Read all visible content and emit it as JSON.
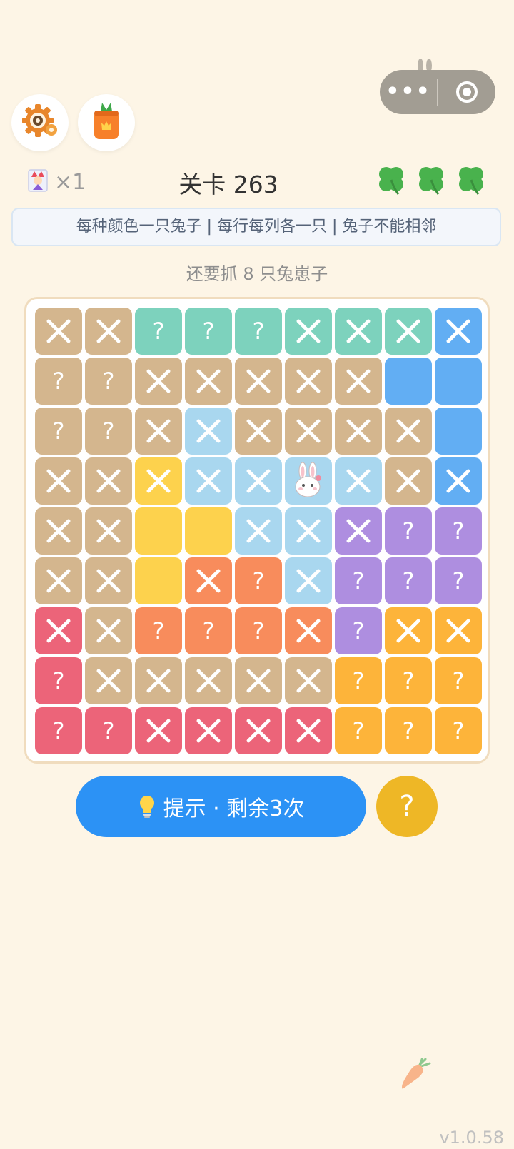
{
  "colors": {
    "tan": "#d4b68e",
    "teal": "#7dd2bd",
    "blue": "#62aef3",
    "lightblue": "#a9d7ef",
    "yellow": "#fdd24d",
    "purple": "#ae8ee0",
    "coral": "#f88c5c",
    "orange": "#fdb43a",
    "red": "#ec6479"
  },
  "capsule": {
    "more_icon": "more-dots-icon",
    "close_icon": "target-icon"
  },
  "header": {
    "level_title": "关卡 263",
    "joker_count": "×1",
    "clovers": 3
  },
  "rules_text": "每种颜色一只兔子 | 每行每列各一只 | 兔子不能相邻",
  "remaining_text": "还要抓 8 只兔崽子",
  "grid": {
    "colors": [
      [
        "tan",
        "tan",
        "teal",
        "teal",
        "teal",
        "teal",
        "teal",
        "teal",
        "blue"
      ],
      [
        "tan",
        "tan",
        "tan",
        "tan",
        "tan",
        "tan",
        "tan",
        "blue",
        "blue"
      ],
      [
        "tan",
        "tan",
        "tan",
        "lightblue",
        "tan",
        "tan",
        "tan",
        "tan",
        "blue"
      ],
      [
        "tan",
        "tan",
        "yellow",
        "lightblue",
        "lightblue",
        "lightblue",
        "lightblue",
        "tan",
        "blue"
      ],
      [
        "tan",
        "tan",
        "yellow",
        "yellow",
        "lightblue",
        "lightblue",
        "purple",
        "purple",
        "purple"
      ],
      [
        "tan",
        "tan",
        "yellow",
        "coral",
        "coral",
        "lightblue",
        "purple",
        "purple",
        "purple"
      ],
      [
        "red",
        "tan",
        "coral",
        "coral",
        "coral",
        "coral",
        "purple",
        "orange",
        "orange"
      ],
      [
        "red",
        "tan",
        "tan",
        "tan",
        "tan",
        "tan",
        "orange",
        "orange",
        "orange"
      ],
      [
        "red",
        "red",
        "red",
        "red",
        "red",
        "red",
        "orange",
        "orange",
        "orange"
      ]
    ],
    "states": [
      [
        "x",
        "x",
        "?",
        "?",
        "?",
        "x",
        "x",
        "x",
        "x"
      ],
      [
        "?",
        "?",
        "x",
        "x",
        "x",
        "x",
        "x",
        "",
        ""
      ],
      [
        "?",
        "?",
        "x",
        "x",
        "x",
        "x",
        "x",
        "x",
        ""
      ],
      [
        "x",
        "x",
        "x",
        "x",
        "x",
        "bunny",
        "x",
        "x",
        "x"
      ],
      [
        "x",
        "x",
        "",
        "",
        "x",
        "x",
        "x",
        "?",
        "?"
      ],
      [
        "x",
        "x",
        "",
        "x",
        "?",
        "x",
        "?",
        "?",
        "?"
      ],
      [
        "x",
        "x",
        "?",
        "?",
        "?",
        "x",
        "?",
        "x",
        "x"
      ],
      [
        "?",
        "x",
        "x",
        "x",
        "x",
        "x",
        "?",
        "?",
        "?"
      ],
      [
        "?",
        "?",
        "x",
        "x",
        "x",
        "x",
        "?",
        "?",
        "?"
      ]
    ]
  },
  "hint_button": {
    "label": "提示 · 剩余3次"
  },
  "help_button": {
    "label": "?"
  },
  "version": "v1.0.58"
}
